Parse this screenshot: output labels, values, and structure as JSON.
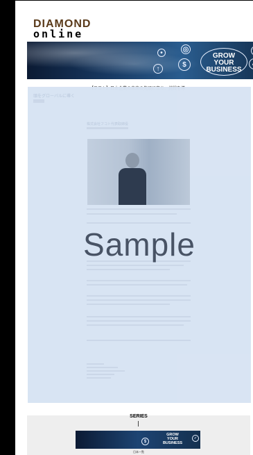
{
  "logo": {
    "top": "DIAMOND",
    "bottom": "online"
  },
  "banner": {
    "line1": "GROW",
    "line2": "YOUR",
    "line3": "BUSINESS"
  },
  "article": {
    "headline": "【フコト】日本企業の未来の先頭に立ち、挑戦を導",
    "sub": "頭をグローバルに導く",
    "caption_block": "株式会社フコト代表取締役",
    "sample_label": "Sample"
  },
  "series": {
    "label": "SERIES",
    "mini_line1": "GROW",
    "mini_line2": "YOUR",
    "mini_line3": "BUSINESS",
    "caption": "日本一覧"
  }
}
